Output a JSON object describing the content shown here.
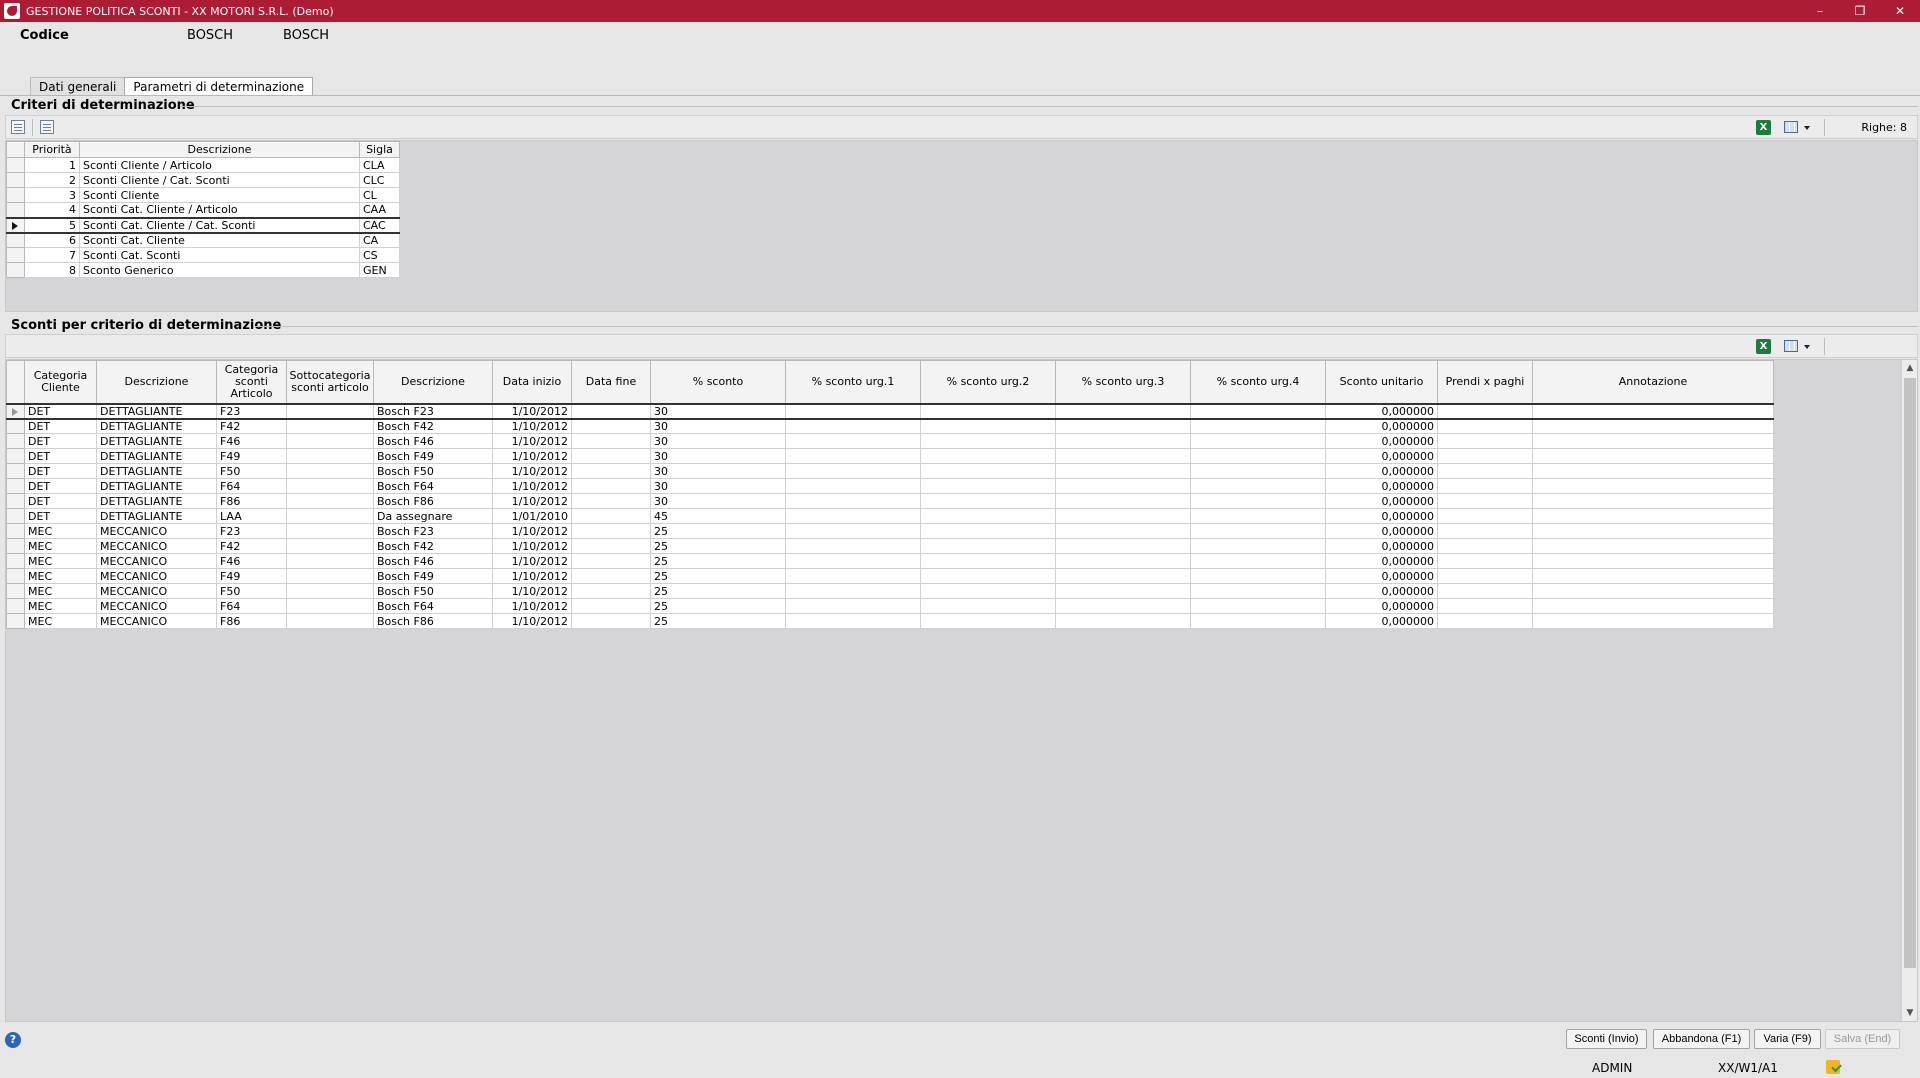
{
  "window": {
    "title": "GESTIONE POLITICA SCONTI - XX  MOTORI S.R.L.  (Demo)",
    "controls": {
      "minimize": "–",
      "restore": "❐",
      "close": "✕"
    }
  },
  "header": {
    "label": "Codice",
    "value1": "BOSCH",
    "value2": "BOSCH"
  },
  "tabs": [
    {
      "label": "Dati generali",
      "active": false
    },
    {
      "label": "Parametri di determinazione",
      "active": true
    }
  ],
  "criteri": {
    "title": "Criteri di determinazione",
    "righe": "Righe: 8",
    "columns": {
      "priorita": "Priorità",
      "descrizione": "Descrizione",
      "sigla": "Sigla"
    },
    "rows": [
      {
        "p": "1",
        "d": "Sconti Cliente / Articolo",
        "s": "CLA"
      },
      {
        "p": "2",
        "d": "Sconti Cliente / Cat. Sconti",
        "s": "CLC"
      },
      {
        "p": "3",
        "d": "Sconti Cliente",
        "s": "CL"
      },
      {
        "p": "4",
        "d": "Sconti Cat. Cliente / Articolo",
        "s": "CAA"
      },
      {
        "p": "5",
        "d": "Sconti Cat. Cliente / Cat. Sconti",
        "s": "CAC"
      },
      {
        "p": "6",
        "d": "Sconti Cat. Cliente",
        "s": "CA"
      },
      {
        "p": "7",
        "d": "Sconti Cat. Sconti",
        "s": "CS"
      },
      {
        "p": "8",
        "d": "Sconto Generico",
        "s": "GEN"
      }
    ],
    "current_row": 5
  },
  "sconti": {
    "title": "Sconti per criterio di determinazione",
    "columns": [
      "Categoria Cliente",
      "Descrizione",
      "Categoria sconti Articolo",
      "Sottocategoria sconti articolo",
      "Descrizione",
      "Data inizio",
      "Data fine",
      "% sconto",
      "% sconto urg.1",
      "% sconto urg.2",
      "% sconto urg.3",
      "% sconto urg.4",
      "Sconto unitario",
      "Prendi x paghi",
      "Annotazione"
    ],
    "rows": [
      [
        "DET",
        "DETTAGLIANTE",
        "F23",
        "",
        "Bosch F23",
        "1/10/2012",
        "",
        "30",
        "",
        "",
        "",
        "",
        "0,000000",
        "",
        ""
      ],
      [
        "DET",
        "DETTAGLIANTE",
        "F42",
        "",
        "Bosch F42",
        "1/10/2012",
        "",
        "30",
        "",
        "",
        "",
        "",
        "0,000000",
        "",
        ""
      ],
      [
        "DET",
        "DETTAGLIANTE",
        "F46",
        "",
        "Bosch F46",
        "1/10/2012",
        "",
        "30",
        "",
        "",
        "",
        "",
        "0,000000",
        "",
        ""
      ],
      [
        "DET",
        "DETTAGLIANTE",
        "F49",
        "",
        "Bosch F49",
        "1/10/2012",
        "",
        "30",
        "",
        "",
        "",
        "",
        "0,000000",
        "",
        ""
      ],
      [
        "DET",
        "DETTAGLIANTE",
        "F50",
        "",
        "Bosch F50",
        "1/10/2012",
        "",
        "30",
        "",
        "",
        "",
        "",
        "0,000000",
        "",
        ""
      ],
      [
        "DET",
        "DETTAGLIANTE",
        "F64",
        "",
        "Bosch F64",
        "1/10/2012",
        "",
        "30",
        "",
        "",
        "",
        "",
        "0,000000",
        "",
        ""
      ],
      [
        "DET",
        "DETTAGLIANTE",
        "F86",
        "",
        "Bosch F86",
        "1/10/2012",
        "",
        "30",
        "",
        "",
        "",
        "",
        "0,000000",
        "",
        ""
      ],
      [
        "DET",
        "DETTAGLIANTE",
        "LAA",
        "",
        "Da assegnare",
        "1/01/2010",
        "",
        "45",
        "",
        "",
        "",
        "",
        "0,000000",
        "",
        ""
      ],
      [
        "MEC",
        "MECCANICO",
        "F23",
        "",
        "Bosch F23",
        "1/10/2012",
        "",
        "25",
        "",
        "",
        "",
        "",
        "0,000000",
        "",
        ""
      ],
      [
        "MEC",
        "MECCANICO",
        "F42",
        "",
        "Bosch F42",
        "1/10/2012",
        "",
        "25",
        "",
        "",
        "",
        "",
        "0,000000",
        "",
        ""
      ],
      [
        "MEC",
        "MECCANICO",
        "F46",
        "",
        "Bosch F46",
        "1/10/2012",
        "",
        "25",
        "",
        "",
        "",
        "",
        "0,000000",
        "",
        ""
      ],
      [
        "MEC",
        "MECCANICO",
        "F49",
        "",
        "Bosch F49",
        "1/10/2012",
        "",
        "25",
        "",
        "",
        "",
        "",
        "0,000000",
        "",
        ""
      ],
      [
        "MEC",
        "MECCANICO",
        "F50",
        "",
        "Bosch F50",
        "1/10/2012",
        "",
        "25",
        "",
        "",
        "",
        "",
        "0,000000",
        "",
        ""
      ],
      [
        "MEC",
        "MECCANICO",
        "F64",
        "",
        "Bosch F64",
        "1/10/2012",
        "",
        "25",
        "",
        "",
        "",
        "",
        "0,000000",
        "",
        ""
      ],
      [
        "MEC",
        "MECCANICO",
        "F86",
        "",
        "Bosch F86",
        "1/10/2012",
        "",
        "25",
        "",
        "",
        "",
        "",
        "0,000000",
        "",
        ""
      ]
    ],
    "current_row": 1
  },
  "buttons": {
    "sconti": "Sconti (Invio)",
    "abbandona": "Abbandona (F1)",
    "varia": "Varia (F9)",
    "salva": "Salva (End)"
  },
  "status": {
    "user": "ADMIN",
    "terminal": "XX/W1/A1"
  },
  "icons": {
    "excel": "X",
    "help": "?"
  }
}
